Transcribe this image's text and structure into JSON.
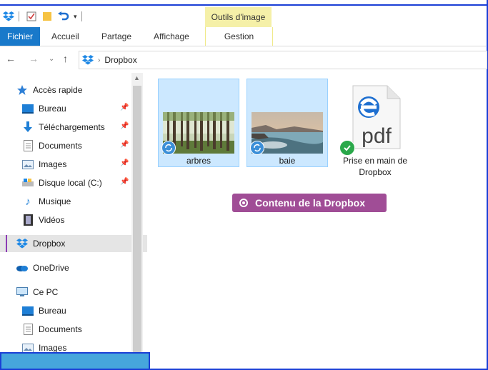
{
  "ribbon": {
    "contextual_group": "Outils d'image",
    "tabs": [
      {
        "label": "Fichier"
      },
      {
        "label": "Accueil"
      },
      {
        "label": "Partage"
      },
      {
        "label": "Affichage"
      },
      {
        "label": "Gestion"
      }
    ]
  },
  "address_bar": {
    "path": "Dropbox"
  },
  "nav_pane": {
    "items": [
      {
        "label": "Accès rapide",
        "icon": "star-icon"
      },
      {
        "label": "Bureau",
        "icon": "desktop-icon",
        "pinned": true
      },
      {
        "label": "Téléchargements",
        "icon": "download-icon",
        "pinned": true
      },
      {
        "label": "Documents",
        "icon": "document-icon",
        "pinned": true
      },
      {
        "label": "Images",
        "icon": "images-icon",
        "pinned": true
      },
      {
        "label": "Disque local (C:)",
        "icon": "drive-icon",
        "pinned": true
      },
      {
        "label": "Musique",
        "icon": "music-icon"
      },
      {
        "label": "Vidéos",
        "icon": "video-icon"
      },
      {
        "label": "Dropbox",
        "icon": "dropbox-icon",
        "selected": true
      },
      {
        "label": "OneDrive",
        "icon": "onedrive-icon"
      },
      {
        "label": "Ce PC",
        "icon": "pc-icon"
      },
      {
        "label": "Bureau",
        "icon": "desktop-icon"
      },
      {
        "label": "Documents",
        "icon": "document-icon"
      },
      {
        "label": "Images",
        "icon": "images-icon"
      }
    ]
  },
  "files": [
    {
      "name": "arbres",
      "type": "image",
      "status": "syncing",
      "selected": true
    },
    {
      "name": "baie",
      "type": "image",
      "status": "syncing",
      "selected": true
    },
    {
      "name": "Prise en main de Dropbox",
      "type": "pdf",
      "status": "synced",
      "selected": false
    }
  ],
  "annotation": {
    "label": "Contenu de la Dropbox"
  },
  "colors": {
    "accent": "#1979ca",
    "contextual_tab": "#f5f0a8",
    "annotation_bg": "#a04d96",
    "selection": "#cce8ff",
    "frame": "#1a3fd6"
  }
}
